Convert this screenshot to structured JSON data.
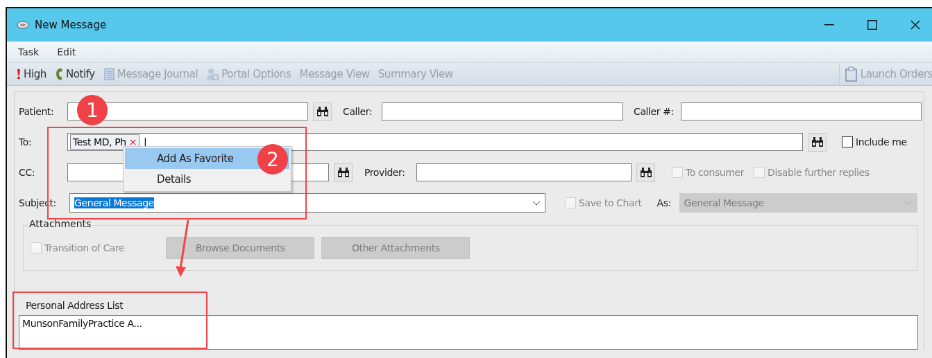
{
  "window": {
    "title": "New Message"
  },
  "menu": [
    "Task",
    "Edit"
  ],
  "toolbar": [
    {
      "label": "High",
      "kind": "priority",
      "disabled": false
    },
    {
      "label": "Notify",
      "kind": "phone",
      "disabled": false
    },
    {
      "label": "Message Journal",
      "kind": "journal",
      "disabled": true
    },
    {
      "label": "Portal Options",
      "kind": "portal",
      "disabled": true
    },
    {
      "label": "Message View",
      "kind": "plain",
      "disabled": true
    },
    {
      "label": "Summary View",
      "kind": "plain",
      "disabled": true
    }
  ],
  "toolbar_right": {
    "label": "Launch Orders",
    "disabled": true
  },
  "form": {
    "patient_label": "Patient:",
    "caller_label": "Caller:",
    "caller_number_label": "Caller #:",
    "to_label": "To:",
    "to_recipient": "Test MD, Ph",
    "to_remove": "×",
    "to_cursor": "|",
    "include_me": {
      "label": "Include me",
      "checked": false,
      "disabled": false
    },
    "cc_label": "CC:",
    "provider_label": "Provider:",
    "to_consumer": {
      "label": "To consumer",
      "checked": false,
      "disabled": true
    },
    "disable_replies": {
      "label": "Disable further replies",
      "checked": false,
      "disabled": true
    },
    "subject_label": "Subject:",
    "subject_value": "General Message",
    "save_to_chart": {
      "label": "Save to Chart",
      "checked": false,
      "disabled": true
    },
    "as_label": "As:",
    "as_value": "General Message"
  },
  "attachments": {
    "title": "Attachments",
    "transition": {
      "label": "Transition of Care",
      "checked": false,
      "disabled": true
    },
    "buttons": [
      {
        "label": "Browse Documents",
        "disabled": true
      },
      {
        "label": "Other Attachments",
        "disabled": true
      }
    ]
  },
  "address_list": {
    "title": "Personal Address List",
    "items": [
      "MunsonFamilyPractice A..."
    ]
  },
  "context_menu": [
    {
      "label": "Add As Favorite",
      "selected": true
    },
    {
      "label": "Details",
      "selected": false
    }
  ],
  "callouts": [
    "1",
    "2"
  ]
}
